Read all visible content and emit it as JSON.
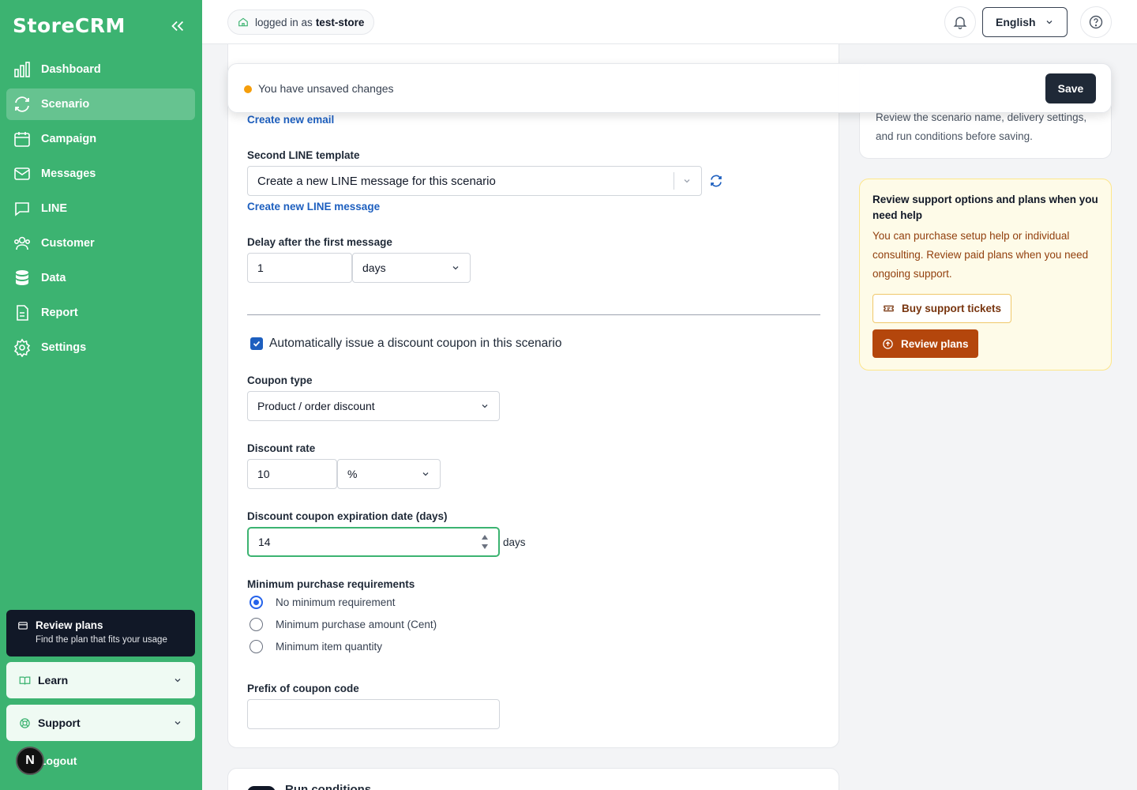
{
  "app": {
    "brand": "StoreCRM"
  },
  "sidebar": {
    "items": [
      {
        "label": "Dashboard",
        "icon": "bar-chart-icon"
      },
      {
        "label": "Scenario",
        "icon": "refresh-cycle-icon",
        "active": true
      },
      {
        "label": "Campaign",
        "icon": "calendar-icon"
      },
      {
        "label": "Messages",
        "icon": "mail-icon"
      },
      {
        "label": "LINE",
        "icon": "chat-bubble-icon"
      },
      {
        "label": "Customer",
        "icon": "users-icon"
      },
      {
        "label": "Data",
        "icon": "database-icon"
      },
      {
        "label": "Report",
        "icon": "document-icon"
      },
      {
        "label": "Settings",
        "icon": "gear-icon"
      }
    ],
    "plan_card": {
      "title": "Review plans",
      "subtitle": "Find the plan that fits your usage"
    },
    "learn": "Learn",
    "support": "Support",
    "logout": "Logout",
    "avatar_initial": "N"
  },
  "topbar": {
    "login_prefix": "logged in as",
    "store": "test-store",
    "language": "English"
  },
  "banner": {
    "message": "You have unsaved changes",
    "save_label": "Save"
  },
  "form": {
    "create_email_link": "Create new email",
    "second_line_label": "Second LINE template",
    "second_line_value": "Create a new LINE message for this scenario",
    "create_line_link": "Create new LINE message",
    "delay_label": "Delay after the first message",
    "delay_value": "1",
    "delay_unit": "days",
    "coupon_checkbox_label": "Automatically issue a discount coupon in this scenario",
    "coupon_checked": true,
    "coupon_type_label": "Coupon type",
    "coupon_type_value": "Product / order discount",
    "discount_rate_label": "Discount rate",
    "discount_rate_value": "10",
    "discount_rate_unit": "%",
    "expiration_label": "Discount coupon expiration date (days)",
    "expiration_value": "14",
    "expiration_unit": "days",
    "min_purchase_label": "Minimum purchase requirements",
    "min_purchase_options": [
      {
        "label": "No minimum requirement",
        "selected": true
      },
      {
        "label": "Minimum purchase amount (Cent)",
        "selected": false
      },
      {
        "label": "Minimum item quantity",
        "selected": false
      }
    ],
    "prefix_label": "Prefix of coupon code",
    "prefix_value": ""
  },
  "next_section": {
    "title": "Run conditions"
  },
  "right": {
    "review_text": "Review the scenario name, delivery settings, and run conditions before saving.",
    "support_title": "Review support options and plans when you need help",
    "support_text": "You can purchase setup help or individual consulting. Review paid plans when you need ongoing support.",
    "buy_tickets": "Buy support tickets",
    "review_plans": "Review plans"
  },
  "colors": {
    "sidebar": "#3cb371",
    "link": "#1d5fbf",
    "accent_orange": "#b4460c",
    "dark": "#1f2937"
  }
}
